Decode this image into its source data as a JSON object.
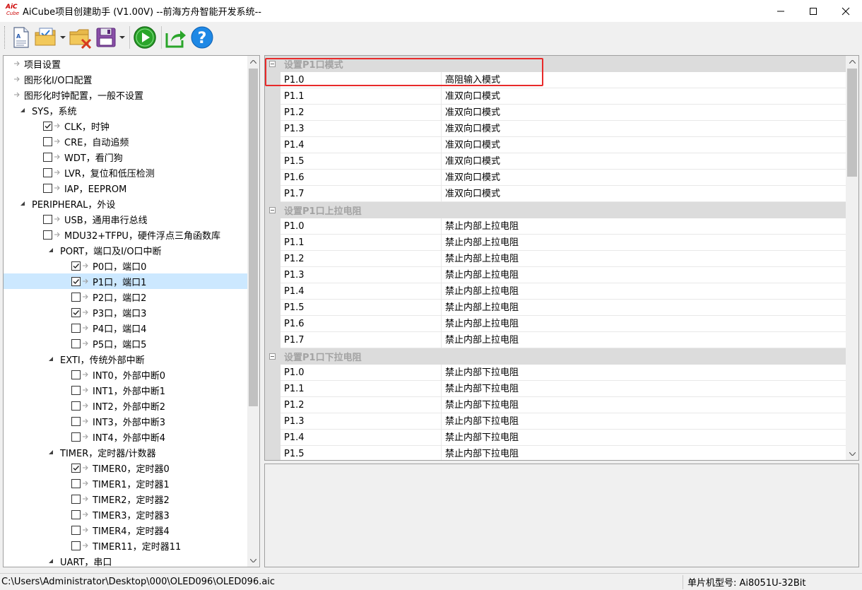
{
  "window": {
    "logo_top": "AiC",
    "logo_bottom": "Cube",
    "title": "AiCube项目创建助手 (V1.00V) --前海方舟智能开发系统--"
  },
  "tree": [
    {
      "label": "项目设置",
      "level": 0,
      "kind": "item"
    },
    {
      "label": "图形化I/O口配置",
      "level": 0,
      "kind": "item"
    },
    {
      "label": "图形化时钟配置，一般不设置",
      "level": 0,
      "kind": "item"
    },
    {
      "label": "SYS，系统",
      "level": 0,
      "kind": "group"
    },
    {
      "label": "CLK，时钟",
      "level": 1,
      "kind": "check",
      "checked": true
    },
    {
      "label": "CRE，自动追频",
      "level": 1,
      "kind": "check",
      "checked": false
    },
    {
      "label": "WDT，看门狗",
      "level": 1,
      "kind": "check",
      "checked": false
    },
    {
      "label": "LVR，复位和低压检测",
      "level": 1,
      "kind": "check",
      "checked": false
    },
    {
      "label": "IAP，EEPROM",
      "level": 1,
      "kind": "check",
      "checked": false
    },
    {
      "label": "PERIPHERAL，外设",
      "level": 0,
      "kind": "group"
    },
    {
      "label": "USB，通用串行总线",
      "level": 1,
      "kind": "check",
      "checked": false
    },
    {
      "label": "MDU32+TFPU，硬件浮点三角函数库",
      "level": 1,
      "kind": "check",
      "checked": false
    },
    {
      "label": "PORT，端口及I/O口中断",
      "level": 1,
      "kind": "group"
    },
    {
      "label": "P0口，端口0",
      "level": 2,
      "kind": "check",
      "checked": true
    },
    {
      "label": "P1口，端口1",
      "level": 2,
      "kind": "check",
      "checked": true,
      "selected": true
    },
    {
      "label": "P2口，端口2",
      "level": 2,
      "kind": "check",
      "checked": false
    },
    {
      "label": "P3口，端口3",
      "level": 2,
      "kind": "check",
      "checked": true
    },
    {
      "label": "P4口，端口4",
      "level": 2,
      "kind": "check",
      "checked": false
    },
    {
      "label": "P5口，端口5",
      "level": 2,
      "kind": "check",
      "checked": false
    },
    {
      "label": "EXTI，传统外部中断",
      "level": 1,
      "kind": "group"
    },
    {
      "label": "INT0，外部中断0",
      "level": 2,
      "kind": "check",
      "checked": false
    },
    {
      "label": "INT1，外部中断1",
      "level": 2,
      "kind": "check",
      "checked": false
    },
    {
      "label": "INT2，外部中断2",
      "level": 2,
      "kind": "check",
      "checked": false
    },
    {
      "label": "INT3，外部中断3",
      "level": 2,
      "kind": "check",
      "checked": false
    },
    {
      "label": "INT4，外部中断4",
      "level": 2,
      "kind": "check",
      "checked": false
    },
    {
      "label": "TIMER，定时器/计数器",
      "level": 1,
      "kind": "group"
    },
    {
      "label": "TIMER0，定时器0",
      "level": 2,
      "kind": "check",
      "checked": true
    },
    {
      "label": "TIMER1，定时器1",
      "level": 2,
      "kind": "check",
      "checked": false
    },
    {
      "label": "TIMER2，定时器2",
      "level": 2,
      "kind": "check",
      "checked": false
    },
    {
      "label": "TIMER3，定时器3",
      "level": 2,
      "kind": "check",
      "checked": false
    },
    {
      "label": "TIMER4，定时器4",
      "level": 2,
      "kind": "check",
      "checked": false
    },
    {
      "label": "TIMER11，定时器11",
      "level": 2,
      "kind": "check",
      "checked": false
    },
    {
      "label": "UART，串口",
      "level": 1,
      "kind": "group"
    }
  ],
  "properties": [
    {
      "category": "设置P1口模式",
      "rows": [
        {
          "name": "P1.0",
          "value": "高阻输入模式"
        },
        {
          "name": "P1.1",
          "value": "准双向口模式"
        },
        {
          "name": "P1.2",
          "value": "准双向口模式"
        },
        {
          "name": "P1.3",
          "value": "准双向口模式"
        },
        {
          "name": "P1.4",
          "value": "准双向口模式"
        },
        {
          "name": "P1.5",
          "value": "准双向口模式"
        },
        {
          "name": "P1.6",
          "value": "准双向口模式"
        },
        {
          "name": "P1.7",
          "value": "准双向口模式"
        }
      ]
    },
    {
      "category": "设置P1口上拉电阻",
      "rows": [
        {
          "name": "P1.0",
          "value": "禁止内部上拉电阻"
        },
        {
          "name": "P1.1",
          "value": "禁止内部上拉电阻"
        },
        {
          "name": "P1.2",
          "value": "禁止内部上拉电阻"
        },
        {
          "name": "P1.3",
          "value": "禁止内部上拉电阻"
        },
        {
          "name": "P1.4",
          "value": "禁止内部上拉电阻"
        },
        {
          "name": "P1.5",
          "value": "禁止内部上拉电阻"
        },
        {
          "name": "P1.6",
          "value": "禁止内部上拉电阻"
        },
        {
          "name": "P1.7",
          "value": "禁止内部上拉电阻"
        }
      ]
    },
    {
      "category": "设置P1口下拉电阻",
      "rows": [
        {
          "name": "P1.0",
          "value": "禁止内部下拉电阻"
        },
        {
          "name": "P1.1",
          "value": "禁止内部下拉电阻"
        },
        {
          "name": "P1.2",
          "value": "禁止内部下拉电阻"
        },
        {
          "name": "P1.3",
          "value": "禁止内部下拉电阻"
        },
        {
          "name": "P1.4",
          "value": "禁止内部下拉电阻"
        },
        {
          "name": "P1.5",
          "value": "禁止内部下拉电阻"
        }
      ]
    }
  ],
  "status": {
    "path": "C:\\Users\\Administrator\\Desktop\\000\\OLED096\\OLED096.aic",
    "model": "单片机型号:  Ai8051U-32Bit"
  },
  "colors": {
    "selection": "#cce8ff",
    "highlight_box": "#e82a2a",
    "category_text": "#a3a3a3",
    "run_icon": "#2aa52a",
    "help_icon": "#1e88e5"
  }
}
